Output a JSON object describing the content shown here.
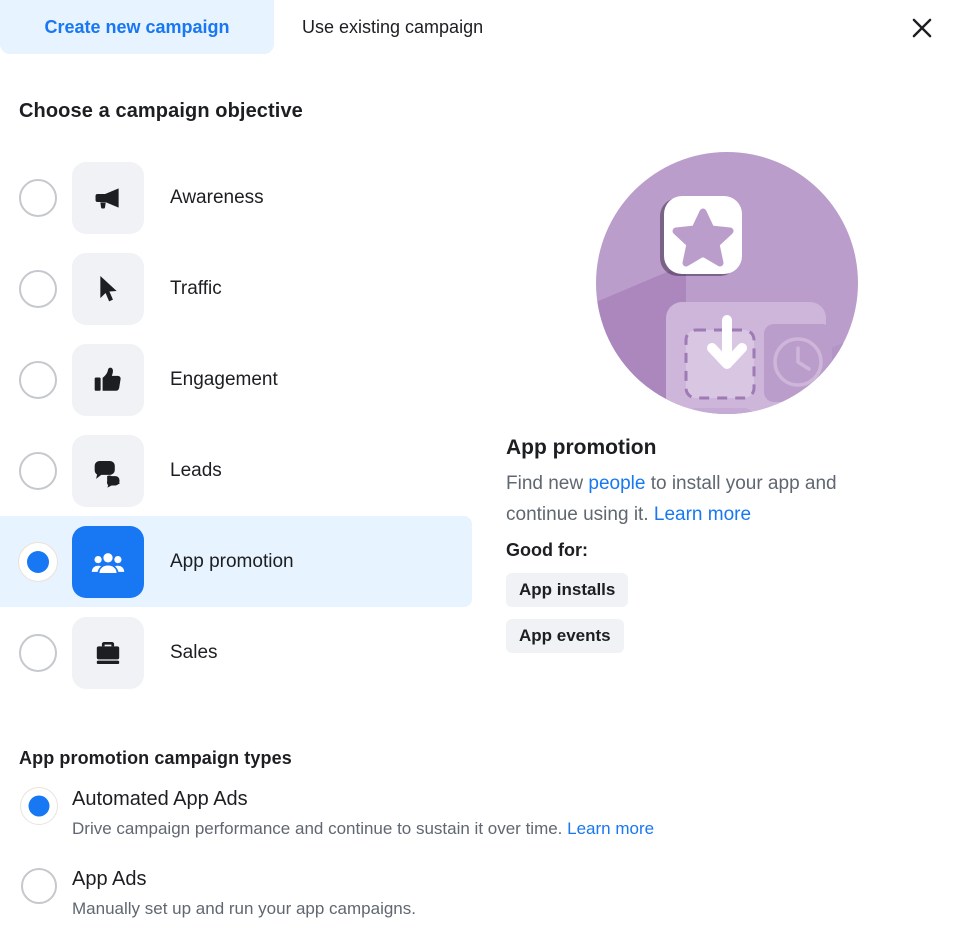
{
  "window": {
    "close_icon": "close-icon"
  },
  "tabs": [
    {
      "label": "Create new campaign",
      "active": true
    },
    {
      "label": "Use existing campaign",
      "active": false
    }
  ],
  "objective_section": {
    "heading": "Choose a campaign objective",
    "options": [
      {
        "label": "Awareness",
        "icon": "megaphone-icon",
        "selected": false
      },
      {
        "label": "Traffic",
        "icon": "cursor-icon",
        "selected": false
      },
      {
        "label": "Engagement",
        "icon": "thumbs-up-icon",
        "selected": false
      },
      {
        "label": "Leads",
        "icon": "chat-bubbles-icon",
        "selected": false
      },
      {
        "label": "App promotion",
        "icon": "people-icon",
        "selected": true
      },
      {
        "label": "Sales",
        "icon": "briefcase-icon",
        "selected": false
      }
    ]
  },
  "detail": {
    "illustration_icon": "app-install-illustration",
    "title": "App promotion",
    "desc_part1": "Find new ",
    "desc_link1": "people",
    "desc_part2": " to install your app and continue using it. ",
    "desc_link2": "Learn more",
    "good_for_label": "Good for:",
    "chips": [
      "App installs",
      "App events"
    ]
  },
  "campaign_types": {
    "heading": "App promotion campaign types",
    "options": [
      {
        "title": "Automated App Ads",
        "desc": "Drive campaign performance and continue to sustain it over time. ",
        "link": "Learn more",
        "selected": true
      },
      {
        "title": "App Ads",
        "desc": "Manually set up and run your app campaigns.",
        "link": "",
        "selected": false
      }
    ]
  },
  "colors": {
    "accent": "#1877f2",
    "accent_bg": "#e7f3ff",
    "tile_bg": "#f0f2f5",
    "text": "#1c1e21",
    "muted": "#606770",
    "illustration_purple": "#bb9dcb"
  }
}
